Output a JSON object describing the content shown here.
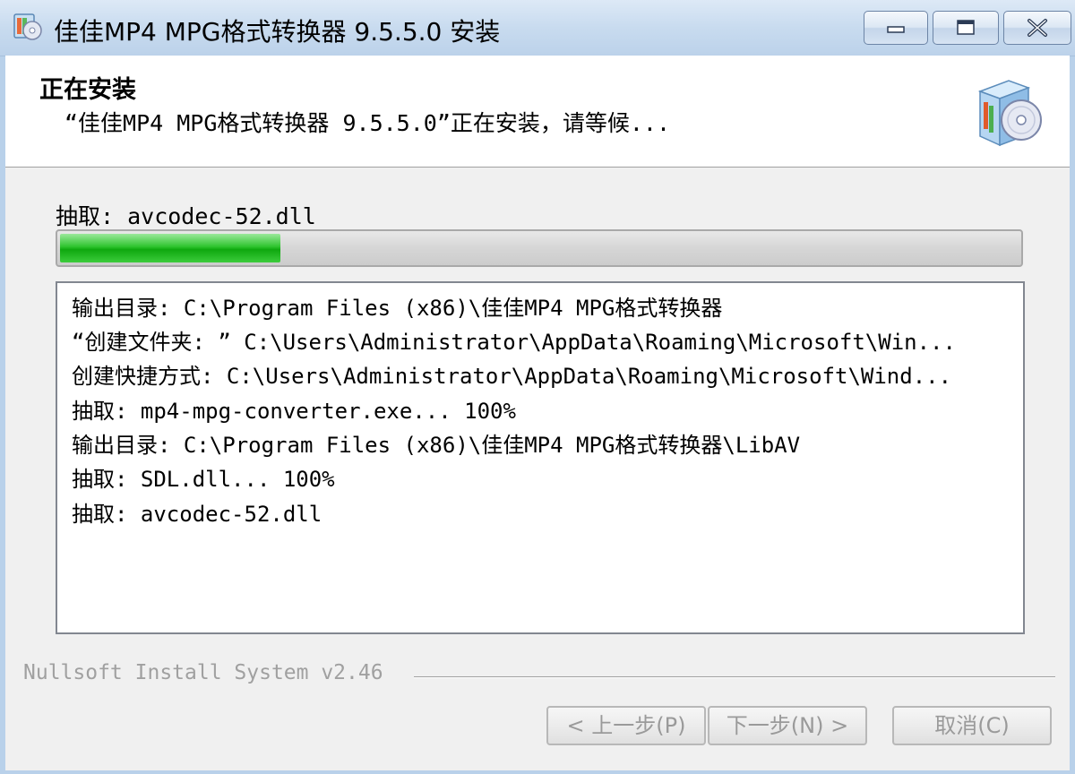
{
  "window": {
    "title": "佳佳MP4 MPG格式转换器 9.5.5.0 安装"
  },
  "header": {
    "title": "正在安装",
    "subtitle": "“佳佳MP4 MPG格式转换器 9.5.5.0”正在安装，请等候..."
  },
  "status": {
    "label": "抽取: avcodec-52.dll",
    "progress_fraction": 0.23
  },
  "log": [
    "输出目录: C:\\Program Files (x86)\\佳佳MP4 MPG格式转换器",
    "“创建文件夹: ” C:\\Users\\Administrator\\AppData\\Roaming\\Microsoft\\Win...",
    "创建快捷方式: C:\\Users\\Administrator\\AppData\\Roaming\\Microsoft\\Wind...",
    "抽取: mp4-mpg-converter.exe... 100%",
    "输出目录: C:\\Program Files (x86)\\佳佳MP4 MPG格式转换器\\LibAV",
    "抽取: SDL.dll... 100%",
    "抽取: avcodec-52.dll"
  ],
  "branding": "Nullsoft Install System v2.46",
  "buttons": {
    "back": "< 上一步(P)",
    "next": "下一步(N) >",
    "cancel": "取消(C)"
  },
  "icons": {
    "app": "installer-cd-icon",
    "header": "software-box-cd-icon",
    "minimize": "minimize-icon",
    "maximize": "maximize-icon",
    "close": "close-icon"
  }
}
